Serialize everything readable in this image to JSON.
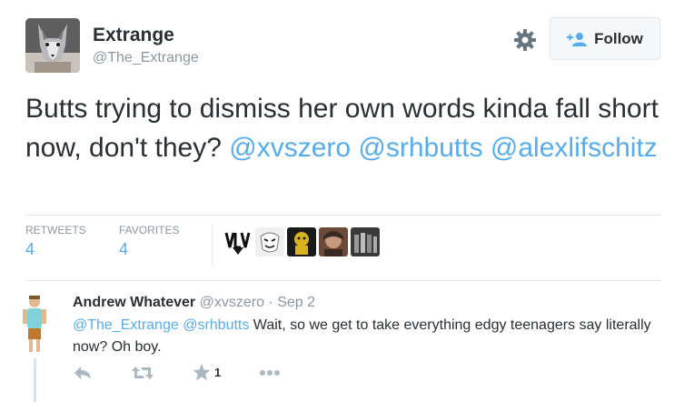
{
  "tweet": {
    "author_name": "Extrange",
    "author_handle": "@The_Extrange",
    "follow_label": "Follow",
    "text_plain_1": "Butts trying to dismiss her own words kinda fall short now, don't they? ",
    "mention_1": "@xvszero",
    "mention_2": "@srhbutts",
    "mention_3": "@alexlifschitz",
    "retweets_label": "RETWEETS",
    "retweets_count": "4",
    "favorites_label": "FAVORITES",
    "favorites_count": "4",
    "avatar_icon": "wolf-avatar-icon",
    "colors": {
      "accent": "#55acee",
      "text": "#292f33",
      "muted": "#8899a6"
    }
  },
  "reply": {
    "author_name": "Andrew Whatever",
    "author_handle": "@xvszero",
    "separator": " · ",
    "date": "Sep 2",
    "mention_1": "@The_Extrange",
    "mention_2": "@srhbutts",
    "text": " Wait, so we get to take everything edgy teenagers say literally now?  Oh boy.",
    "favorite_count": "1"
  }
}
